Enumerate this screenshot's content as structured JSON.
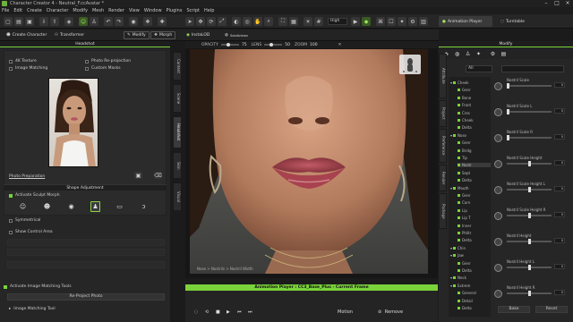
{
  "app": {
    "title": "Character Creator 4 - Neutral_F.ccAvatar *"
  },
  "window_controls": [
    "–",
    "□",
    "×"
  ],
  "menu": [
    "File",
    "Edit",
    "Create",
    "Character",
    "Modify",
    "Mesh",
    "Render",
    "View",
    "Window",
    "Plugins",
    "Script",
    "Help"
  ],
  "toolbar": {
    "quality": "High",
    "animation_player": "Animation Player",
    "turntable": "Turntable"
  },
  "toolbar2": {
    "create_character": "Create Character",
    "transformer": "Transformer",
    "modify": "Modify",
    "morph": "Morph",
    "install_do": "InstaLOD",
    "subdivision": "Subdivision"
  },
  "left_panel": {
    "title": "Headshot",
    "opt_4k": "4K Texture",
    "opt_photo_reproj": "Photo Re-projection",
    "opt_image_matching": "Image Matching",
    "opt_custom_masks": "Custom Masks",
    "photo_preparation": "Photo Preparation",
    "shape_adjustment": "Shape Adjustment",
    "activate_sculpt": "Activate Sculpt Morph",
    "symmetrical": "Symmetrical",
    "show_control_area": "Show Control Area",
    "activate_image_matching": "Activate Image Matching Tools",
    "reproject_photo": "Re-Project Photo",
    "image_matching_tool": "Image Matching Tool"
  },
  "side_tabs": [
    "Content",
    "Scene",
    "Headshot",
    "Skin",
    "Visual"
  ],
  "viewport": {
    "opacity_label": "OPACITY",
    "opacity_value": "75",
    "lens_label": "LENS",
    "lens_value": "50",
    "zoom_label": "ZOOM",
    "zoom_value": "100",
    "caption": "Nose > Nostrils > Nostril Width"
  },
  "anim_player": {
    "title": "Animation Player : CC3_Base_Plus - Current Frame",
    "motion": "Motion",
    "remove": "Remove"
  },
  "right_panel": {
    "title": "Modify",
    "filter": "All",
    "vtabs": [
      "Attribute",
      "Project",
      "Preference",
      "Render",
      "Package"
    ],
    "tree": [
      {
        "label": "Cheek",
        "indent": 0,
        "on": true
      },
      {
        "label": "Genr",
        "indent": 1,
        "on": true
      },
      {
        "label": "Bone",
        "indent": 1,
        "on": true
      },
      {
        "label": "Front",
        "indent": 1,
        "on": true
      },
      {
        "label": "Cres",
        "indent": 1,
        "on": true
      },
      {
        "label": "Cheek",
        "indent": 1,
        "on": true
      },
      {
        "label": "Delta",
        "indent": 1,
        "on": true
      },
      {
        "label": "Nose",
        "indent": 0,
        "on": true
      },
      {
        "label": "Genr",
        "indent": 1,
        "on": true
      },
      {
        "label": "Bridg",
        "indent": 1,
        "on": true
      },
      {
        "label": "Tip",
        "indent": 1,
        "on": true
      },
      {
        "label": "Nostr",
        "indent": 1,
        "on": true,
        "selected": true
      },
      {
        "label": "Sept",
        "indent": 1,
        "on": true
      },
      {
        "label": "Delta",
        "indent": 1,
        "on": true
      },
      {
        "label": "Mouth",
        "indent": 0,
        "on": true
      },
      {
        "label": "Genr",
        "indent": 1,
        "on": true
      },
      {
        "label": "Corn",
        "indent": 1,
        "on": true
      },
      {
        "label": "Lip",
        "indent": 1,
        "on": true
      },
      {
        "label": "Lip T",
        "indent": 1,
        "on": true
      },
      {
        "label": "Inner",
        "indent": 1,
        "on": true
      },
      {
        "label": "Philtr",
        "indent": 1,
        "on": true
      },
      {
        "label": "Delta",
        "indent": 1,
        "on": true
      },
      {
        "label": "Chin",
        "indent": 0,
        "on": true
      },
      {
        "label": "Jaw",
        "indent": 0,
        "on": true
      },
      {
        "label": "Genr",
        "indent": 1,
        "on": true
      },
      {
        "label": "Delta",
        "indent": 1,
        "on": true
      },
      {
        "label": "Neck",
        "indent": 0,
        "on": true
      },
      {
        "label": "Extrem",
        "indent": 0,
        "on": true
      },
      {
        "label": "General",
        "indent": 1,
        "on": true
      },
      {
        "label": "Detail",
        "indent": 1,
        "on": true
      },
      {
        "label": "Delta",
        "indent": 1,
        "on": true
      }
    ],
    "sliders": [
      {
        "label": "Nostril Scale",
        "value": "0",
        "pos": 0.0
      },
      {
        "label": "Nostril Scale L",
        "value": "0",
        "pos": 0.0
      },
      {
        "label": "Nostril Scale R",
        "value": "0",
        "pos": 0.0
      },
      {
        "label": "Nostril Scale Height",
        "value": "0",
        "pos": 0.5
      },
      {
        "label": "Nostril Scale Height L",
        "value": "0",
        "pos": 0.5
      },
      {
        "label": "Nostril Scale Height R",
        "value": "0",
        "pos": 0.5
      },
      {
        "label": "Nostril Height",
        "value": "0",
        "pos": 0.5
      },
      {
        "label": "Nostril Height L",
        "value": "0",
        "pos": 0.5
      },
      {
        "label": "Nostril Height R",
        "value": "0",
        "pos": 0.5
      }
    ],
    "btn_bake": "Bake",
    "btn_reset": "Reset"
  }
}
